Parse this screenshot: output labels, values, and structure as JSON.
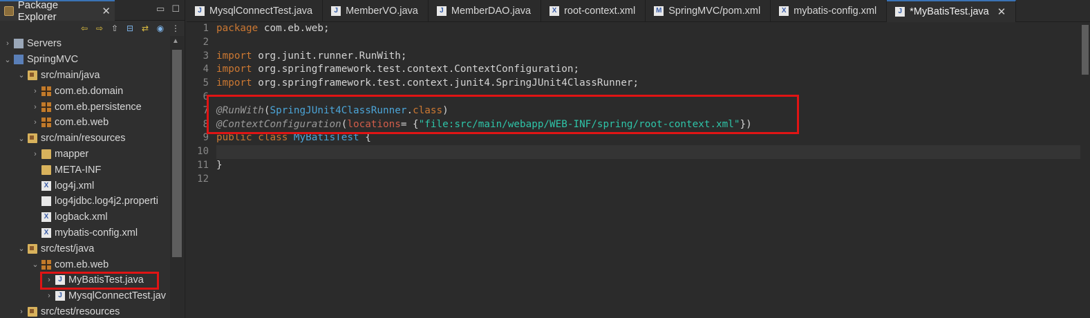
{
  "explorer": {
    "tab_label": "Package Explorer",
    "tree": [
      {
        "label": "Servers",
        "depth": 0,
        "caret": ">",
        "icon": "servers-folder-icon"
      },
      {
        "label": "SpringMVC",
        "depth": 0,
        "caret": "v",
        "icon": "project-icon"
      },
      {
        "label": "src/main/java",
        "depth": 1,
        "caret": "v",
        "icon": "source-folder-icon"
      },
      {
        "label": "com.eb.domain",
        "depth": 2,
        "caret": ">",
        "icon": "package-icon"
      },
      {
        "label": "com.eb.persistence",
        "depth": 2,
        "caret": ">",
        "icon": "package-icon"
      },
      {
        "label": "com.eb.web",
        "depth": 2,
        "caret": ">",
        "icon": "package-icon"
      },
      {
        "label": "src/main/resources",
        "depth": 1,
        "caret": "v",
        "icon": "source-folder-icon"
      },
      {
        "label": "mapper",
        "depth": 2,
        "caret": ">",
        "icon": "folder-icon"
      },
      {
        "label": "META-INF",
        "depth": 2,
        "caret": "",
        "icon": "folder-icon"
      },
      {
        "label": "log4j.xml",
        "depth": 2,
        "caret": "",
        "icon": "xml-file-icon"
      },
      {
        "label": "log4jdbc.log4j2.properti",
        "depth": 2,
        "caret": "",
        "icon": "text-file-icon"
      },
      {
        "label": "logback.xml",
        "depth": 2,
        "caret": "",
        "icon": "xml-file-icon"
      },
      {
        "label": "mybatis-config.xml",
        "depth": 2,
        "caret": "",
        "icon": "xml-file-icon"
      },
      {
        "label": "src/test/java",
        "depth": 1,
        "caret": "v",
        "icon": "source-folder-icon"
      },
      {
        "label": "com.eb.web",
        "depth": 2,
        "caret": "v",
        "icon": "package-icon"
      },
      {
        "label": "MyBatisTest.java",
        "depth": 3,
        "caret": ">",
        "icon": "java-file-icon"
      },
      {
        "label": "MysqlConnectTest.jav",
        "depth": 3,
        "caret": ">",
        "icon": "java-file-icon"
      },
      {
        "label": "src/test/resources",
        "depth": 1,
        "caret": ">",
        "icon": "source-folder-icon"
      }
    ]
  },
  "editor": {
    "tabs": [
      {
        "label": "MysqlConnectTest.java",
        "icon": "java-file-icon",
        "active": false
      },
      {
        "label": "MemberVO.java",
        "icon": "java-file-icon",
        "active": false
      },
      {
        "label": "MemberDAO.java",
        "icon": "java-file-icon",
        "active": false
      },
      {
        "label": "root-context.xml",
        "icon": "xml-file-icon",
        "active": false
      },
      {
        "label": "SpringMVC/pom.xml",
        "icon": "maven-file-icon",
        "active": false
      },
      {
        "label": "mybatis-config.xml",
        "icon": "xml-file-icon",
        "active": false
      },
      {
        "label": "*MyBatisTest.java",
        "icon": "java-file-icon",
        "active": true
      }
    ],
    "line_numbers": [
      "1",
      "2",
      "3",
      "4",
      "5",
      "6",
      "7",
      "8",
      "9",
      "10",
      "11",
      "12"
    ],
    "code": {
      "l1_kw": "package",
      "l1_rest": " com.eb.web;",
      "l3_kw": "import",
      "l3_rest": " org.junit.runner.RunWith;",
      "l4_kw": "import",
      "l4_rest": " org.springframework.test.context.ContextConfiguration;",
      "l5_kw": "import",
      "l5_rest": " org.springframework.test.context.junit4.SpringJUnit4ClassRunner;",
      "l7_ann": "@RunWith",
      "l7_p1": "(",
      "l7_cls": "SpringJUnit4ClassRunner",
      "l7_p2": ".",
      "l7_kw": "class",
      "l7_p3": ")",
      "l8_ann": "@ContextConfiguration",
      "l8_p1": "(",
      "l8_prm": "locations",
      "l8_p2": "= {",
      "l8_str": "\"file:src/main/webapp/WEB-INF/spring/root-context.xml\"",
      "l8_p3": "})",
      "l9_kw1": "public",
      "l9_sp": " ",
      "l9_kw2": "class",
      "l9_cls": " MyBatisTest",
      "l9_rest": " {",
      "l11": "}"
    }
  },
  "highlight_color": "#e01414"
}
